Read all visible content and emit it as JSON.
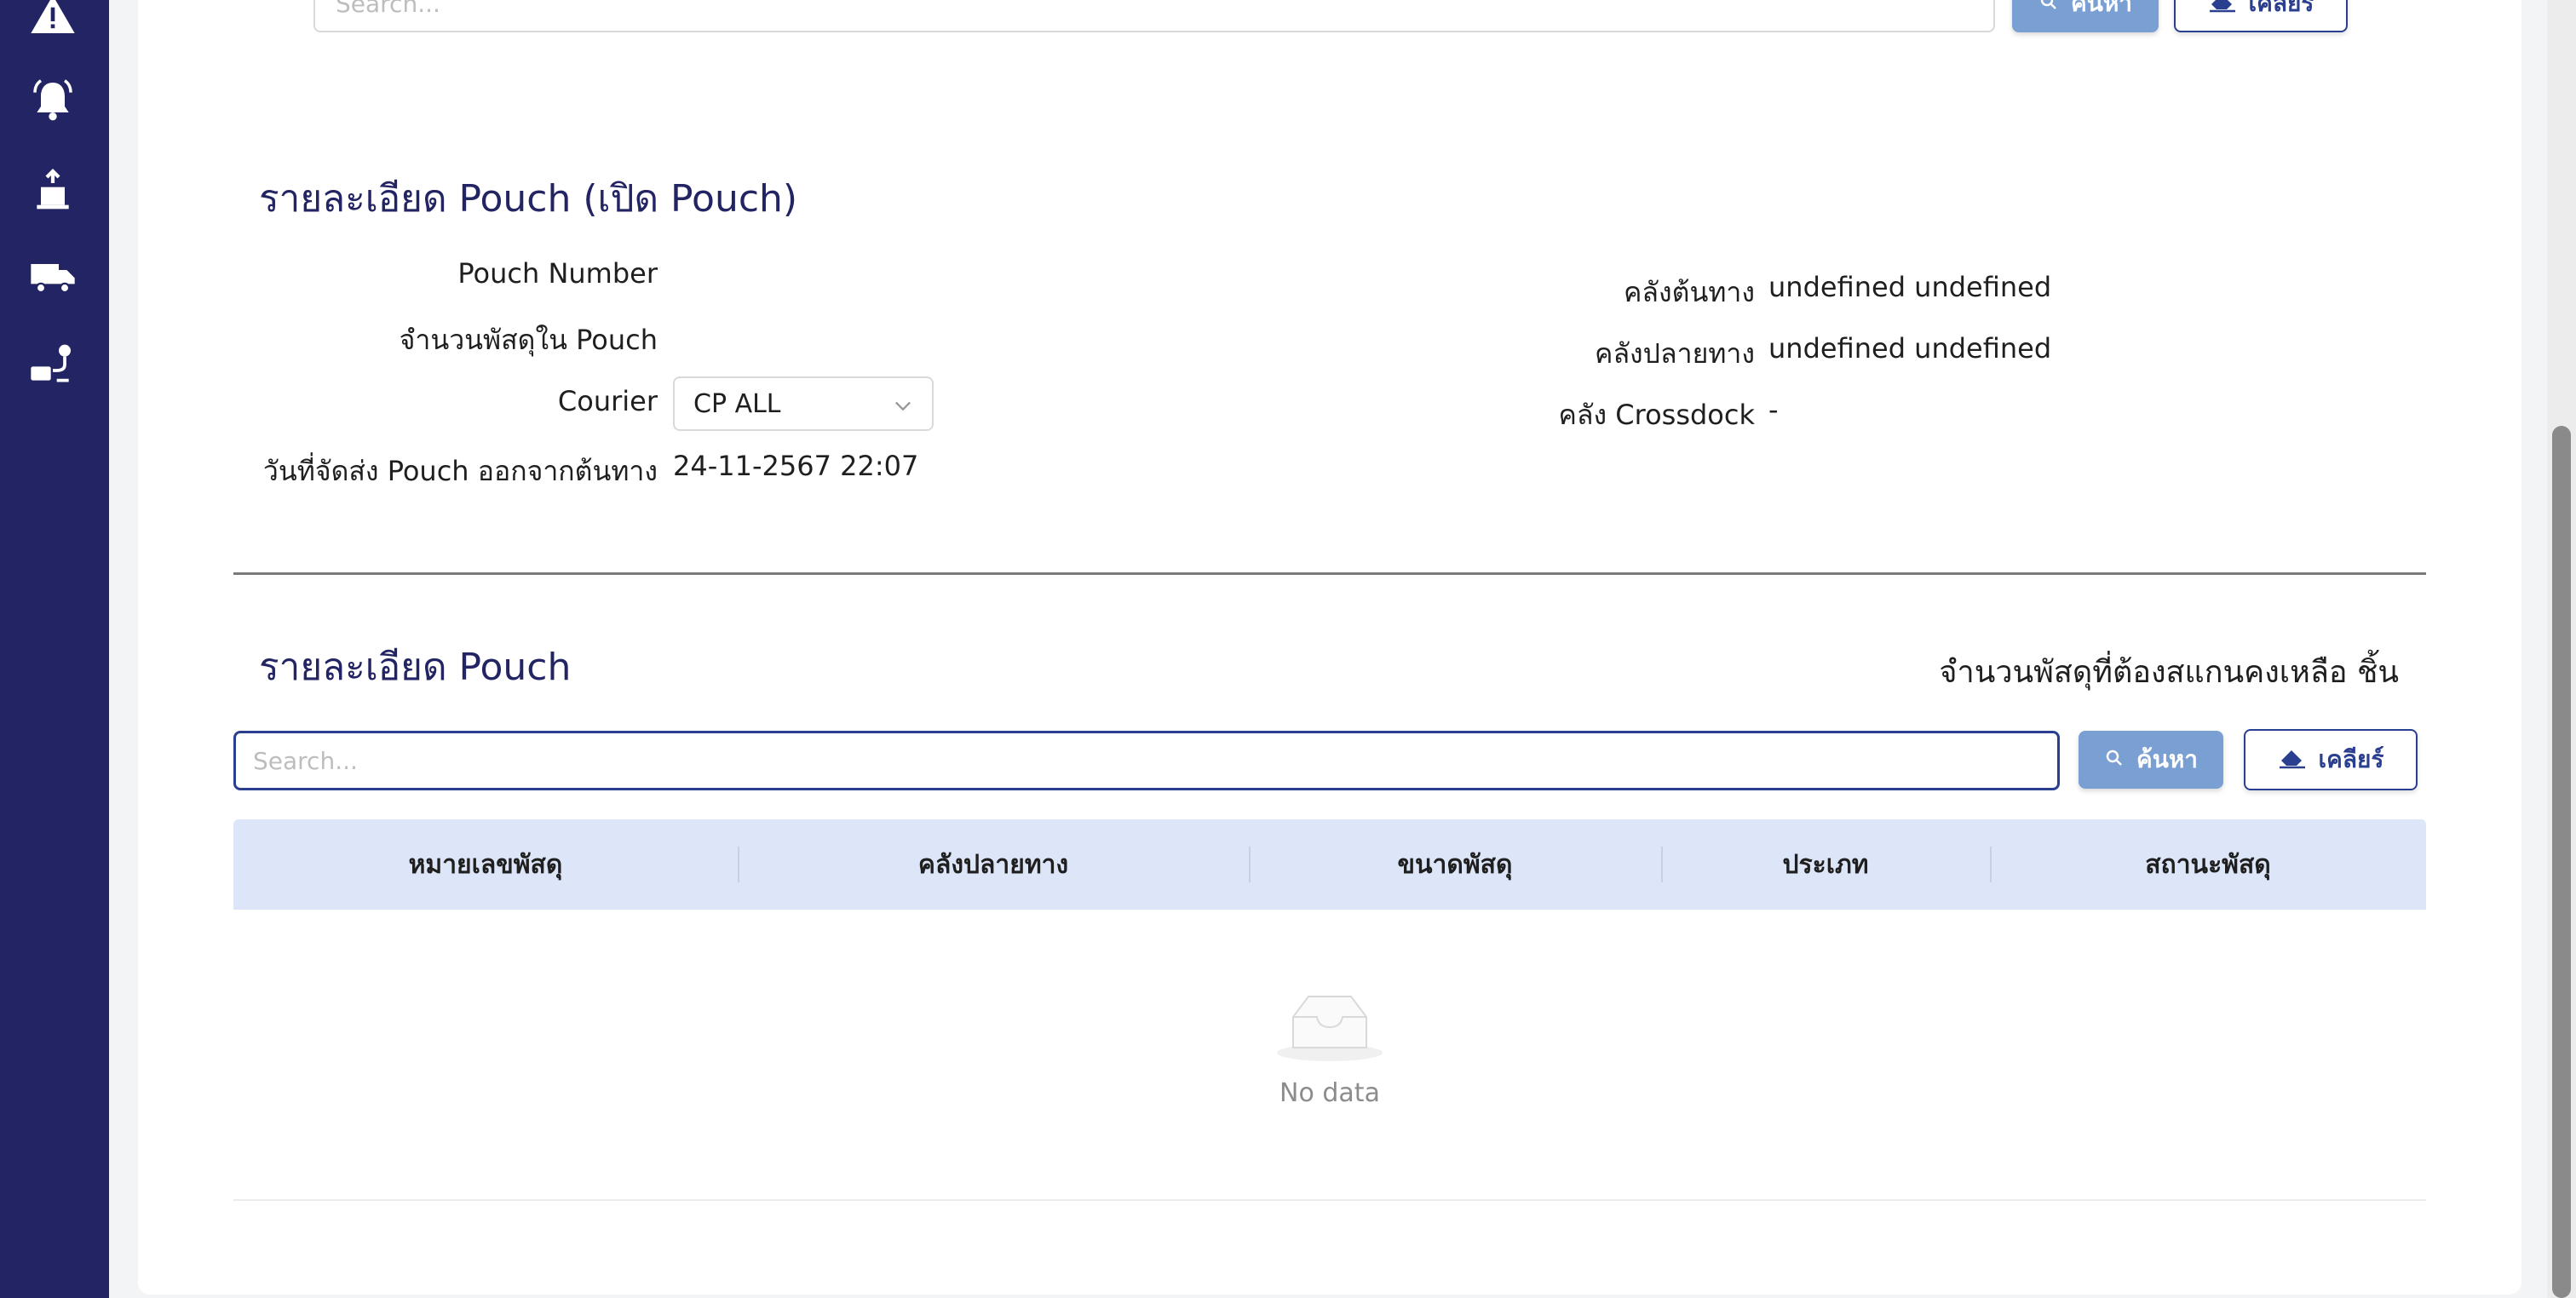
{
  "sidebar": {
    "icons": [
      "warning-icon",
      "bell-icon",
      "pallet-upload-icon",
      "truck-icon",
      "route-bus-icon"
    ]
  },
  "top_search": {
    "placeholder": "Search...",
    "search_label": "ค้นหา",
    "clear_label": "เคลียร์"
  },
  "pouch_info": {
    "title": "รายละเอียด Pouch (เปิด Pouch)",
    "fields": {
      "pouch_number_label": "Pouch Number",
      "pouch_number_value": "",
      "parcel_count_label": "จำนวนพัสดุใน Pouch",
      "parcel_count_value": "",
      "courier_label": "Courier",
      "courier_value": "CP ALL",
      "ship_date_label": "วันที่จัดส่ง Pouch ออกจากต้นทาง",
      "ship_date_value": "24-11-2567 22:07",
      "origin_label": "คลังต้นทาง",
      "origin_value": "undefined undefined",
      "destination_label": "คลังปลายทาง",
      "destination_value": "undefined undefined",
      "crossdock_label": "คลัง Crossdock",
      "crossdock_value": "-"
    }
  },
  "pouch_detail": {
    "title": "รายละเอียด Pouch",
    "remaining_label": "จำนวนพัสดุที่ต้องสแกนคงเหลือ ชิ้น",
    "search_placeholder": "Search...",
    "search_label": "ค้นหา",
    "clear_label": "เคลียร์",
    "table": {
      "columns": [
        "หมายเลขพัสดุ",
        "คลังปลายทาง",
        "ขนาดพัสดุ",
        "ประเภท",
        "สถานะพัสดุ"
      ],
      "rows": [],
      "empty_text": "No data"
    }
  },
  "colors": {
    "sidebar": "#232463",
    "accent": "#2a3f8f",
    "primary_button": "#7a9fd3",
    "table_header": "#dde6f8"
  }
}
